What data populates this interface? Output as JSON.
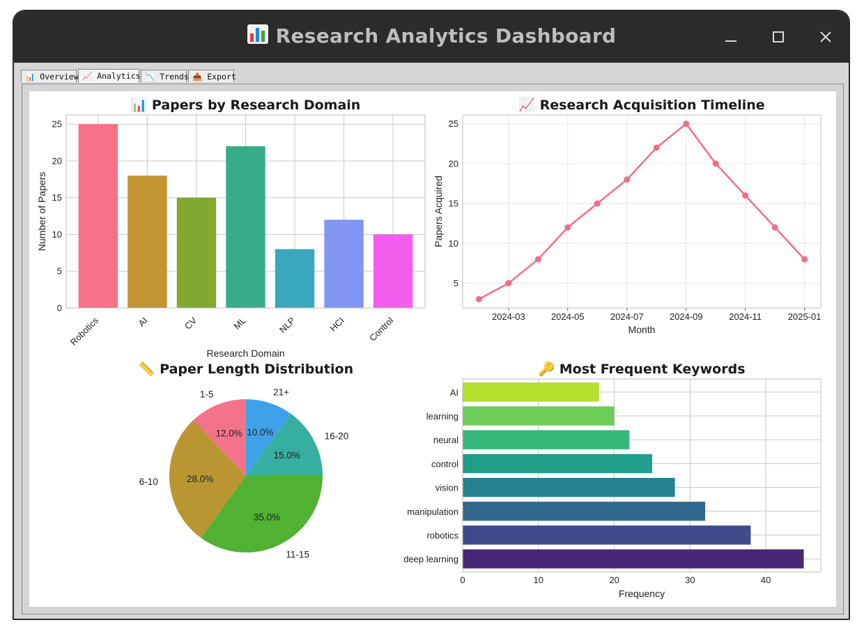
{
  "window": {
    "title": "Research Analytics Dashboard",
    "title_icon": "bar-chart-icon",
    "controls": [
      "minimize-icon",
      "maximize-icon",
      "close-icon"
    ]
  },
  "tabs": [
    {
      "label": "📊 Overview",
      "active": false
    },
    {
      "label": "📈 Analytics",
      "active": true
    },
    {
      "label": "📉 Trends",
      "active": false
    },
    {
      "label": "📤 Export",
      "active": false
    }
  ],
  "chart_data": [
    {
      "type": "bar",
      "title": "📊 Papers by Research Domain",
      "xlabel": "Research Domain",
      "ylabel": "Number of Papers",
      "categories": [
        "Robotics",
        "AI",
        "CV",
        "ML",
        "NLP",
        "HCI",
        "Control"
      ],
      "values": [
        25,
        18,
        15,
        22,
        8,
        12,
        10
      ],
      "colors": [
        "#f77189",
        "#c39532",
        "#82a832",
        "#36ad88",
        "#39a8bc",
        "#8296f3",
        "#f35deb"
      ],
      "ylim": [
        0,
        26.25
      ],
      "yticks": [
        0,
        5,
        10,
        15,
        20,
        25
      ],
      "grid": true
    },
    {
      "type": "line",
      "title": "📈 Research Acquisition Timeline",
      "xlabel": "Month",
      "ylabel": "Papers Acquired",
      "x": [
        "2024-02",
        "2024-03",
        "2024-04",
        "2024-05",
        "2024-06",
        "2024-07",
        "2024-08",
        "2024-09",
        "2024-10",
        "2024-11",
        "2024-12",
        "2025-01"
      ],
      "values": [
        3,
        5,
        8,
        12,
        15,
        18,
        22,
        25,
        20,
        16,
        12,
        8
      ],
      "xticks": [
        "2024-03",
        "2024-05",
        "2024-07",
        "2024-09",
        "2024-11",
        "2025-01"
      ],
      "yticks": [
        5,
        10,
        15,
        20,
        25
      ],
      "ylim": [
        1.9,
        26.1
      ],
      "color": "#f06f86",
      "grid": true
    },
    {
      "type": "pie",
      "title": "📏 Paper Length Distribution",
      "slices": [
        {
          "label": "21+",
          "value": 10.0,
          "pct": "10.0%",
          "color": "#3ea2ea"
        },
        {
          "label": "16-20",
          "value": 15.0,
          "pct": "15.0%",
          "color": "#36aea0"
        },
        {
          "label": "11-15",
          "value": 35.0,
          "pct": "35.0%",
          "color": "#50b132"
        },
        {
          "label": "6-10",
          "value": 28.0,
          "pct": "28.0%",
          "color": "#b99632"
        },
        {
          "label": "1-5",
          "value": 12.0,
          "pct": "12.0%",
          "color": "#f4728a"
        }
      ]
    },
    {
      "type": "bar",
      "orientation": "horizontal",
      "title": "🔑 Most Frequent Keywords",
      "xlabel": "Frequency",
      "categories": [
        "deep learning",
        "robotics",
        "manipulation",
        "vision",
        "control",
        "neural",
        "learning",
        "AI"
      ],
      "values": [
        45,
        38,
        32,
        28,
        25,
        22,
        20,
        18
      ],
      "colors": [
        "#482677",
        "#3e4a89",
        "#31688e",
        "#26828e",
        "#1f9e89",
        "#35b779",
        "#6dcd59",
        "#b4de2c"
      ],
      "xlim": [
        0,
        47.25
      ],
      "xticks": [
        0,
        10,
        20,
        30,
        40
      ],
      "grid": true
    }
  ]
}
